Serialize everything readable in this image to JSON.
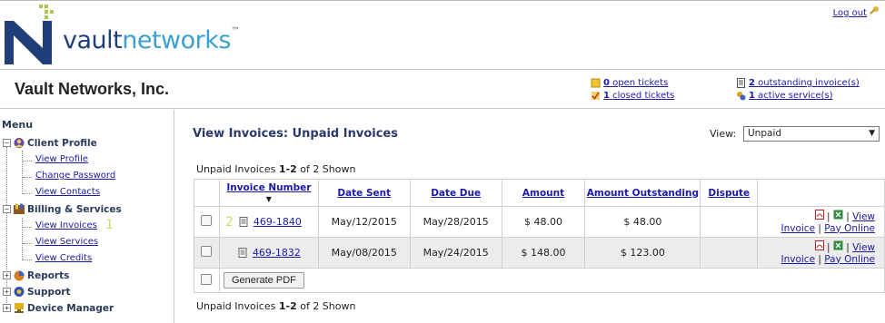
{
  "brand": {
    "name_a": "vault",
    "name_b": "networks",
    "tm": "™"
  },
  "logout": "Log out",
  "company": "Vault Networks, Inc.",
  "stats": {
    "open_tickets_count": "0",
    "open_tickets_label": "open tickets",
    "closed_tickets_count": "1",
    "closed_tickets_label": "closed tickets",
    "outstanding_count": "2",
    "outstanding_label": "outstanding invoice(s)",
    "active_count": "1",
    "active_label": "active service(s)"
  },
  "menu": {
    "title": "Menu",
    "client_profile": "Client Profile",
    "view_profile": "View Profile",
    "change_password": "Change Password",
    "view_contacts": "View Contacts",
    "billing": "Billing & Services",
    "view_invoices": "View Invoices",
    "view_services": "View Services",
    "view_credits": "View Credits",
    "reports": "Reports",
    "support": "Support",
    "device_manager": "Device Manager",
    "marker": "1"
  },
  "main": {
    "title": "View Invoices: Unpaid Invoices",
    "view_label": "View:",
    "view_value": "Unpaid",
    "count_prefix": "Unpaid Invoices ",
    "count_range": "1-2",
    "count_suffix": " of 2 Shown"
  },
  "table": {
    "headers": [
      "Invoice Number",
      "Date Sent",
      "Date Due",
      "Amount",
      "Amount Outstanding",
      "Dispute"
    ],
    "rows": [
      {
        "marker": "2",
        "invoice": "469-1840",
        "sent": "May/12/2015",
        "due": "May/28/2015",
        "amount": "$ 48.00",
        "outstanding": "$ 48.00"
      },
      {
        "marker": "",
        "invoice": "469-1832",
        "sent": "May/08/2015",
        "due": "May/24/2015",
        "amount": "$ 148.00",
        "outstanding": "$ 123.00"
      }
    ],
    "sep": "|",
    "view_invoice_a": "View",
    "view_invoice_b": "Invoice",
    "pay_online": "Pay Online",
    "generate_pdf": "Generate PDF"
  }
}
